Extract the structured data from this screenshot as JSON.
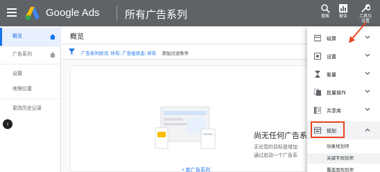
{
  "header": {
    "app_name": "Google Ads",
    "account_name": "所有广告系列",
    "search_label": "搜索",
    "report_label": "报告",
    "tools_label_line1": "工具与",
    "tools_label_line2": "设置"
  },
  "sidebar": {
    "items": [
      {
        "label": "概览"
      },
      {
        "label": "广告系列"
      },
      {
        "label": "设置"
      },
      {
        "label": "地理位置"
      },
      {
        "label": "更改历史记录"
      }
    ]
  },
  "main": {
    "page_title": "概览",
    "filter": {
      "campaign_status_label": "广告系列状况:",
      "campaign_status_value": "所有;",
      "adgroup_status_label": "广告组状态:",
      "adgroup_status_value": "所有",
      "add_filter": "添加过滤条件"
    },
    "empty_title": "尚无任何广告系",
    "empty_desc_line1": "无论您的目标是增加",
    "empty_desc_line2": "通过启动一个广告系",
    "new_campaign": "+ 新广告系列"
  },
  "tools_menu": {
    "items": [
      {
        "label": "结算",
        "icon": "billing-icon"
      },
      {
        "label": "设置",
        "icon": "settings-icon"
      },
      {
        "label": "衡量",
        "icon": "measurement-icon"
      },
      {
        "label": "批量操作",
        "icon": "bulk-actions-icon"
      },
      {
        "label": "共享库",
        "icon": "shared-library-icon"
      },
      {
        "label": "规划",
        "icon": "planning-icon"
      }
    ],
    "planning_sub": [
      {
        "label": "效果规划师"
      },
      {
        "label": "关键字规划师"
      },
      {
        "label": "覆盖面规划师"
      }
    ]
  },
  "colors": {
    "header_bg": "#5f6368",
    "accent": "#1a73e8",
    "highlight": "#e8441f"
  }
}
